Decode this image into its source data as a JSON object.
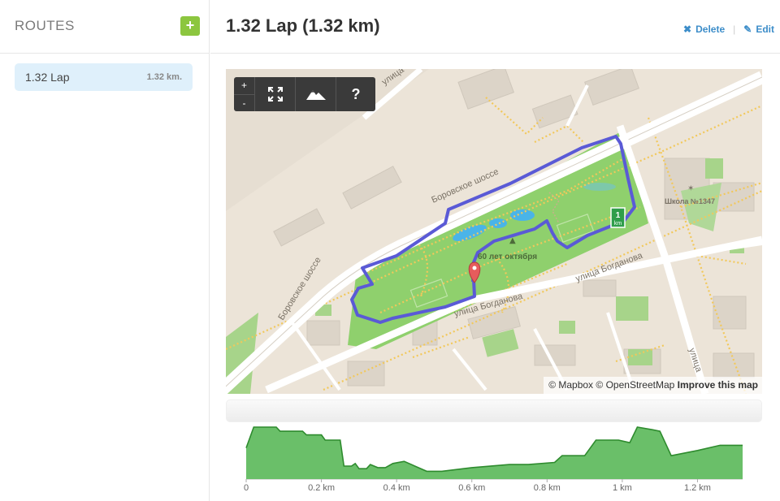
{
  "sidebar": {
    "title": "ROUTES",
    "add_label": "+",
    "routes": [
      {
        "name": "1.32 Lap",
        "distance": "1.32 km."
      }
    ]
  },
  "header": {
    "title": "1.32 Lap (1.32 km)",
    "delete_label": "Delete",
    "edit_label": "Edit"
  },
  "map": {
    "zoom_in": "+",
    "zoom_out": "-",
    "help_label": "?",
    "streets": {
      "borovskoe_1": "Боровское шоссе",
      "borovskoe_2": "Боровское шоссе",
      "bogdanova_1": "улица Богданова",
      "bogdanova_2": "улица Богданова",
      "tereshkovoy": "улица Терешк",
      "right_street": "улица"
    },
    "park_label": "60 лет октября",
    "school_label": "Школа №1347",
    "km_marker": "1",
    "km_marker_unit": "km",
    "attribution": {
      "mapbox": "© Mapbox",
      "osm": "© OpenStreetMap",
      "improve": "Improve this map"
    },
    "route_color": "#5a5ad6",
    "pin_color": "#e65c5c"
  },
  "elevation": {
    "fill_color": "#6abf69",
    "line_color": "#2e8b2e",
    "x_ticks": [
      "0",
      "0.2 km",
      "0.4 km",
      "0.6 km",
      "0.8 km",
      "1 km",
      "1.2 km"
    ],
    "profile": [
      [
        0.0,
        0.6
      ],
      [
        0.02,
        1.0
      ],
      [
        0.08,
        1.0
      ],
      [
        0.09,
        0.92
      ],
      [
        0.15,
        0.92
      ],
      [
        0.16,
        0.85
      ],
      [
        0.2,
        0.85
      ],
      [
        0.21,
        0.75
      ],
      [
        0.25,
        0.75
      ],
      [
        0.26,
        0.25
      ],
      [
        0.28,
        0.25
      ],
      [
        0.29,
        0.3
      ],
      [
        0.3,
        0.2
      ],
      [
        0.32,
        0.2
      ],
      [
        0.33,
        0.28
      ],
      [
        0.35,
        0.22
      ],
      [
        0.37,
        0.22
      ],
      [
        0.39,
        0.3
      ],
      [
        0.42,
        0.34
      ],
      [
        0.48,
        0.15
      ],
      [
        0.52,
        0.15
      ],
      [
        0.6,
        0.22
      ],
      [
        0.7,
        0.28
      ],
      [
        0.75,
        0.28
      ],
      [
        0.82,
        0.32
      ],
      [
        0.84,
        0.45
      ],
      [
        0.9,
        0.45
      ],
      [
        0.93,
        0.75
      ],
      [
        0.99,
        0.75
      ],
      [
        1.02,
        0.7
      ],
      [
        1.04,
        1.0
      ],
      [
        1.08,
        0.95
      ],
      [
        1.1,
        0.92
      ],
      [
        1.13,
        0.45
      ],
      [
        1.2,
        0.55
      ],
      [
        1.26,
        0.65
      ],
      [
        1.32,
        0.65
      ]
    ]
  }
}
